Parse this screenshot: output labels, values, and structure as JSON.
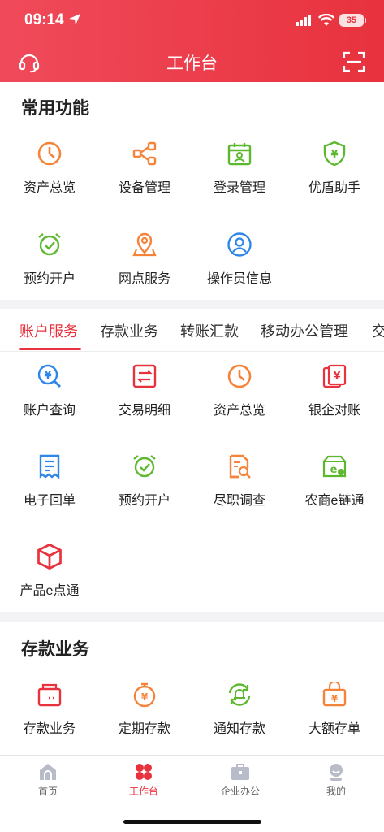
{
  "status": {
    "time": "09:14",
    "battery": "35"
  },
  "header": {
    "title": "工作台"
  },
  "common": {
    "title": "常用功能",
    "items": [
      {
        "label": "资产总览",
        "icon": "pie-chart-icon"
      },
      {
        "label": "设备管理",
        "icon": "share-nodes-icon"
      },
      {
        "label": "登录管理",
        "icon": "calendar-user-icon"
      },
      {
        "label": "优盾助手",
        "icon": "shield-yuan-icon"
      },
      {
        "label": "预约开户",
        "icon": "alarm-clock-icon"
      },
      {
        "label": "网点服务",
        "icon": "map-pin-icon"
      },
      {
        "label": "操作员信息",
        "icon": "user-circle-icon"
      }
    ]
  },
  "tabs": [
    "账户服务",
    "存款业务",
    "转账汇款",
    "移动办公管理",
    "交"
  ],
  "account": {
    "items": [
      {
        "label": "账户查询",
        "icon": "search-yuan-icon"
      },
      {
        "label": "交易明细",
        "icon": "transfer-list-icon"
      },
      {
        "label": "资产总览",
        "icon": "pie-chart-icon"
      },
      {
        "label": "银企对账",
        "icon": "cards-yuan-icon"
      },
      {
        "label": "电子回单",
        "icon": "receipt-icon"
      },
      {
        "label": "预约开户",
        "icon": "alarm-clock-icon"
      },
      {
        "label": "尽职调查",
        "icon": "document-search-icon"
      },
      {
        "label": "农商e链通",
        "icon": "e-chain-icon"
      },
      {
        "label": "产品e点通",
        "icon": "cube-icon"
      }
    ]
  },
  "deposit": {
    "title": "存款业务",
    "items": [
      {
        "label": "存款业务",
        "icon": "deposit-box-icon"
      },
      {
        "label": "定期存款",
        "icon": "timer-yuan-icon"
      },
      {
        "label": "通知存款",
        "icon": "bell-refresh-icon"
      },
      {
        "label": "大额存单",
        "icon": "bag-yuan-icon"
      }
    ]
  },
  "bottom_nav": [
    {
      "label": "首页",
      "icon": "home-icon"
    },
    {
      "label": "工作台",
      "icon": "workbench-icon",
      "active": true
    },
    {
      "label": "企业办公",
      "icon": "briefcase-icon"
    },
    {
      "label": "我的",
      "icon": "profile-icon"
    }
  ],
  "colors": {
    "brand": "#e8323e",
    "orange": "#f5833a",
    "green": "#5cb82e",
    "blue": "#2f86e8"
  }
}
